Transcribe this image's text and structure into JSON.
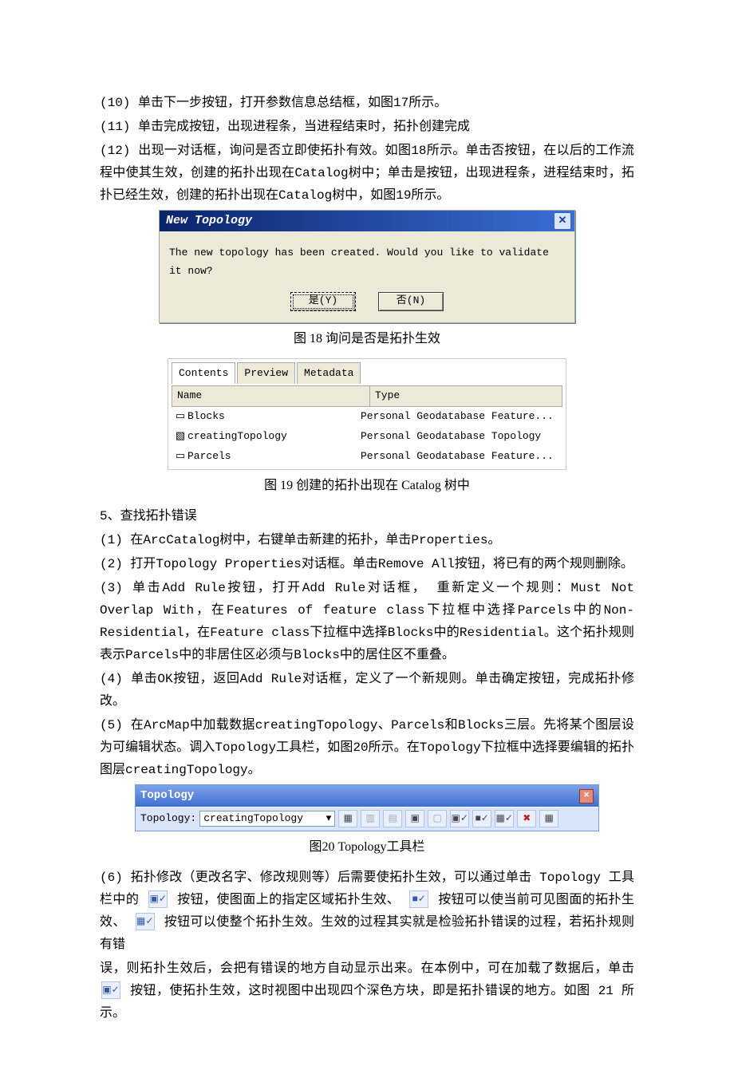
{
  "paragraphs": {
    "p10": "(10) 单击下一步按钮，打开参数信息总结框，如图17所示。",
    "p11": "(11) 单击完成按钮，出现进程条，当进程结束时，拓扑创建完成",
    "p12": "(12) 出现一对话框，询问是否立即使拓扑有效。如图18所示。单击否按钮，在以后的工作流程中使其生效，创建的拓扑出现在Catalog树中；单击是按钮，出现进程条，进程结束时，拓扑已经生效，创建的拓扑出现在Catalog树中，如图19所示。"
  },
  "fig18": {
    "title": "New Topology",
    "message": "The new topology has been created. Would you like to validate it now?",
    "yes": "是(Y)",
    "no": "否(N)",
    "caption": "图 18  询问是否是拓扑生效"
  },
  "fig19": {
    "tabs": {
      "contents": "Contents",
      "preview": "Preview",
      "metadata": "Metadata"
    },
    "col_name": "Name",
    "col_type": "Type",
    "rows": [
      {
        "icon": "▭",
        "name": "Blocks",
        "type": "Personal Geodatabase Feature..."
      },
      {
        "icon": "▧",
        "name": "creatingTopology",
        "type": "Personal Geodatabase Topology"
      },
      {
        "icon": "▭",
        "name": "Parcels",
        "type": "Personal Geodatabase Feature..."
      }
    ],
    "caption": "图 19  创建的拓扑出现在 Catalog 树中"
  },
  "section5": {
    "head": "  5、查找拓扑错误",
    "s1": "(1) 在ArcCatalog树中，右键单击新建的拓扑，单击Properties。",
    "s2": "(2) 打开Topology Properties对话框。单击Remove All按钮，将已有的两个规则删除。",
    "s3": "(3) 单击Add Rule按钮，打开Add Rule对话框， 重新定义一个规则：Must Not Overlap With，在Features of feature class下拉框中选择Parcels中的Non-Residential，在Feature class下拉框中选择Blocks中的Residential。这个拓扑规则表示Parcels中的非居住区必须与Blocks中的居住区不重叠。",
    "s4": "(4) 单击OK按钮，返回Add Rule对话框，定义了一个新规则。单击确定按钮，完成拓扑修改。",
    "s5": "(5) 在ArcMap中加载数据creatingTopology、Parcels和Blocks三层。先将某个图层设为可编辑状态。调入Topology工具栏，如图20所示。在Topology下拉框中选择要编辑的拓扑图层creatingTopology。"
  },
  "fig20": {
    "title": "Topology",
    "label": "Topology:",
    "selected": "creatingTopology",
    "caption": "图20 Topology工具栏"
  },
  "section6": {
    "a": "(6) 拓扑修改（更改名字、修改规则等）后需要使拓扑生效，可以通过单击 Topology 工具栏中的",
    "b": "按钮，使图面上的指定区域拓扑生效、",
    "c": "按钮可以使当前可见图面的拓扑生效、",
    "d": "按钮可以使整个拓扑生效。生效的过程其实就是检验拓扑错误的过程，若拓扑规则有错",
    "e": "误，则拓扑生效后，会把有错误的地方自动显示出来。在本例中，可在加载了数据后，单击",
    "f": "按钮，使拓扑生效，这时视图中出现四个深色方块，即是拓扑错误的地方。如图 21 所示。"
  }
}
